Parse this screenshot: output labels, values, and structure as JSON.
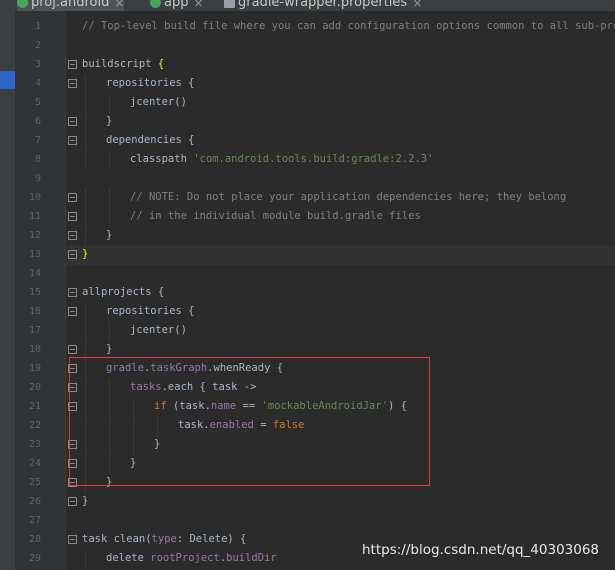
{
  "tabs": [
    {
      "label": "proj.android",
      "active": true
    },
    {
      "label": "app",
      "active": false
    },
    {
      "label": "gradle-wrapper.properties",
      "active": false
    }
  ],
  "editor": {
    "lines": [
      {
        "num": "1",
        "indent": 0,
        "fold": false,
        "parts": [
          [
            "cm",
            "// Top-level build file where you can add configuration options common to all sub-project"
          ]
        ]
      },
      {
        "num": "2",
        "indent": 0,
        "fold": false,
        "parts": []
      },
      {
        "num": "3",
        "indent": 0,
        "fold": true,
        "parts": [
          [
            "pl",
            "buildscript "
          ],
          [
            "br",
            "{"
          ]
        ]
      },
      {
        "num": "4",
        "indent": 1,
        "fold": true,
        "parts": [
          [
            "pl",
            "repositories {"
          ]
        ]
      },
      {
        "num": "5",
        "indent": 2,
        "fold": false,
        "parts": [
          [
            "pl",
            "jcenter()"
          ]
        ]
      },
      {
        "num": "6",
        "indent": 1,
        "fold": true,
        "parts": [
          [
            "pl",
            "}"
          ]
        ]
      },
      {
        "num": "7",
        "indent": 1,
        "fold": true,
        "parts": [
          [
            "pl",
            "dependencies {"
          ]
        ]
      },
      {
        "num": "8",
        "indent": 2,
        "fold": false,
        "parts": [
          [
            "pl",
            "classpath "
          ],
          [
            "st",
            "'com.android.tools.build:gradle:2.2.3'"
          ]
        ]
      },
      {
        "num": "9",
        "indent": 0,
        "fold": false,
        "parts": []
      },
      {
        "num": "10",
        "indent": 2,
        "fold": true,
        "parts": [
          [
            "cm",
            "// NOTE: Do not place your application dependencies here; they belong"
          ]
        ]
      },
      {
        "num": "11",
        "indent": 2,
        "fold": true,
        "parts": [
          [
            "cm",
            "// in the individual module build.gradle files"
          ]
        ]
      },
      {
        "num": "12",
        "indent": 1,
        "fold": true,
        "parts": [
          [
            "pl",
            "}"
          ]
        ]
      },
      {
        "num": "13",
        "indent": 0,
        "fold": true,
        "parts": [
          [
            "br",
            "}"
          ]
        ]
      },
      {
        "num": "14",
        "indent": 0,
        "fold": false,
        "parts": []
      },
      {
        "num": "15",
        "indent": 0,
        "fold": true,
        "parts": [
          [
            "pl",
            "allprojects {"
          ]
        ]
      },
      {
        "num": "16",
        "indent": 1,
        "fold": true,
        "parts": [
          [
            "pl",
            "repositories {"
          ]
        ]
      },
      {
        "num": "17",
        "indent": 2,
        "fold": false,
        "parts": [
          [
            "pl",
            "jcenter()"
          ]
        ]
      },
      {
        "num": "18",
        "indent": 1,
        "fold": true,
        "parts": [
          [
            "pl",
            "}"
          ]
        ]
      },
      {
        "num": "19",
        "indent": 1,
        "fold": true,
        "parts": [
          [
            "pr",
            "gradle"
          ],
          [
            "pl",
            "."
          ],
          [
            "pr",
            "taskGraph"
          ],
          [
            "pl",
            ".whenReady {"
          ]
        ]
      },
      {
        "num": "20",
        "indent": 2,
        "fold": true,
        "parts": [
          [
            "pr",
            "tasks"
          ],
          [
            "pl",
            ".each { task ->"
          ]
        ]
      },
      {
        "num": "21",
        "indent": 3,
        "fold": true,
        "parts": [
          [
            "kw",
            "if "
          ],
          [
            "pl",
            "(task."
          ],
          [
            "pr",
            "name"
          ],
          [
            "pl",
            " == "
          ],
          [
            "st",
            "'mockableAndroidJar'"
          ],
          [
            "pl",
            ") {"
          ]
        ]
      },
      {
        "num": "22",
        "indent": 4,
        "fold": false,
        "parts": [
          [
            "pl",
            "task."
          ],
          [
            "pr",
            "enabled"
          ],
          [
            "pl",
            " = "
          ],
          [
            "kw",
            "false"
          ]
        ]
      },
      {
        "num": "23",
        "indent": 3,
        "fold": true,
        "parts": [
          [
            "pl",
            "}"
          ]
        ]
      },
      {
        "num": "24",
        "indent": 2,
        "fold": true,
        "parts": [
          [
            "pl",
            "}"
          ]
        ]
      },
      {
        "num": "25",
        "indent": 1,
        "fold": true,
        "parts": [
          [
            "pl",
            "}"
          ]
        ]
      },
      {
        "num": "26",
        "indent": 0,
        "fold": true,
        "parts": [
          [
            "pl",
            "}"
          ]
        ]
      },
      {
        "num": "27",
        "indent": 0,
        "fold": false,
        "parts": []
      },
      {
        "num": "28",
        "indent": 0,
        "fold": true,
        "parts": [
          [
            "pl",
            "task clean("
          ],
          [
            "pr",
            "type"
          ],
          [
            "pl",
            ": Delete) {"
          ]
        ]
      },
      {
        "num": "29",
        "indent": 1,
        "fold": false,
        "parts": [
          [
            "pl",
            "delete "
          ],
          [
            "pr",
            "rootProject"
          ],
          [
            "pl",
            "."
          ],
          [
            "pr",
            "buildDir"
          ]
        ]
      }
    ]
  },
  "watermark": "https://blog.csdn.net/qq_40303068",
  "colors": {
    "highlight_border": "#e03a3a",
    "background": "#2b2b2b",
    "gutter": "#313335"
  }
}
